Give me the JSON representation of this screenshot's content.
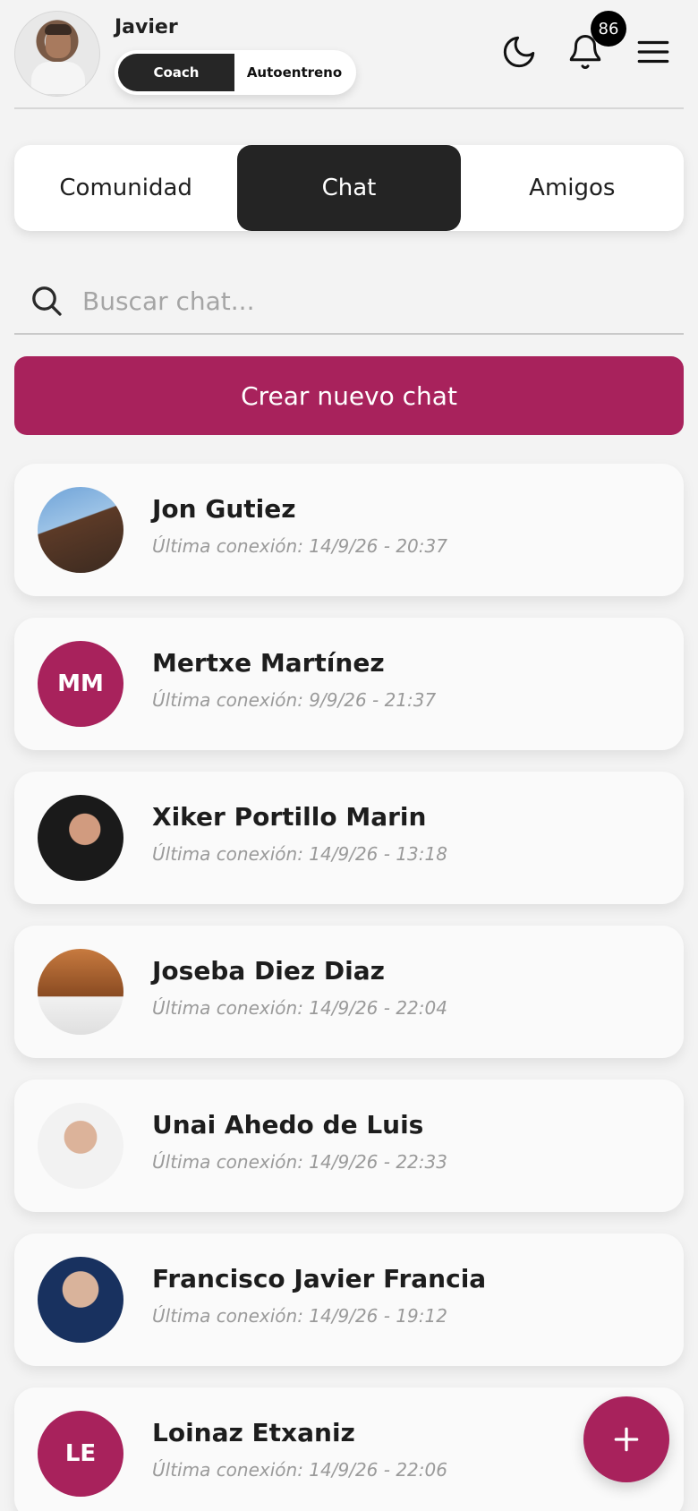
{
  "header": {
    "username": "Javier",
    "mode_toggle": {
      "left": "Coach",
      "right": "Autoentreno",
      "active": "Coach"
    },
    "notifications_count": "86"
  },
  "tabs": [
    {
      "label": "Comunidad",
      "active": false
    },
    {
      "label": "Chat",
      "active": true
    },
    {
      "label": "Amigos",
      "active": false
    }
  ],
  "search": {
    "placeholder": "Buscar chat..."
  },
  "create_button": {
    "label": "Crear nuevo chat"
  },
  "chats": [
    {
      "name": "Jon Gutiez",
      "last_seen": "Última conexión: 14/9/26 - 20:37",
      "avatar_type": "photo",
      "initials": ""
    },
    {
      "name": "Mertxe Martínez",
      "last_seen": "Última conexión: 9/9/26 - 21:37",
      "avatar_type": "initials",
      "initials": "MM"
    },
    {
      "name": "Xiker Portillo Marin",
      "last_seen": "Última conexión: 14/9/26 - 13:18",
      "avatar_type": "photo",
      "initials": ""
    },
    {
      "name": "Joseba Diez Diaz",
      "last_seen": "Última conexión: 14/9/26 - 22:04",
      "avatar_type": "photo",
      "initials": ""
    },
    {
      "name": "Unai Ahedo de Luis",
      "last_seen": "Última conexión: 14/9/26 - 22:33",
      "avatar_type": "photo",
      "initials": ""
    },
    {
      "name": "Francisco Javier Francia",
      "last_seen": "Última conexión: 14/9/26 - 19:12",
      "avatar_type": "photo",
      "initials": ""
    },
    {
      "name": "Loinaz Etxaniz",
      "last_seen": "Última conexión: 14/9/26 - 22:06",
      "avatar_type": "initials",
      "initials": "LE"
    }
  ],
  "colors": {
    "accent": "#a8225c",
    "dark": "#242424",
    "background": "#f3f3f3"
  },
  "icons": [
    "moon-icon",
    "bell-icon",
    "menu-icon",
    "search-icon",
    "plus-icon"
  ]
}
